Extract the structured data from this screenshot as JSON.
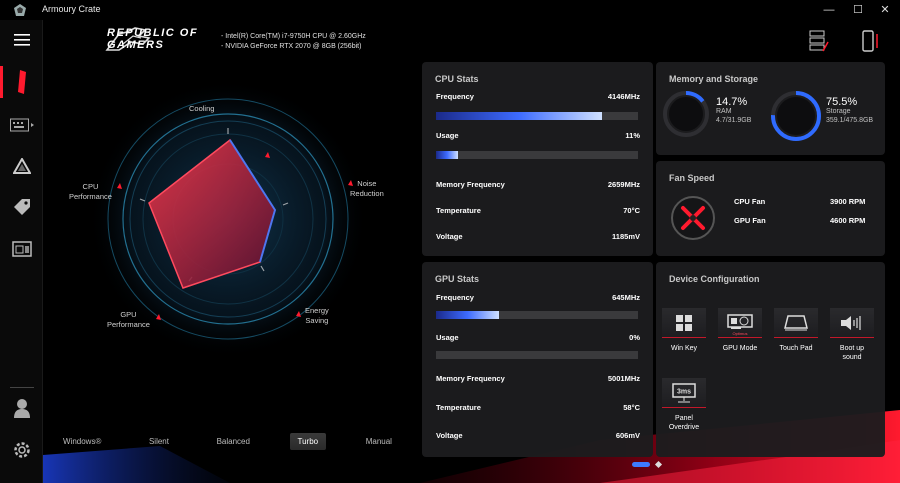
{
  "window": {
    "title": "Armoury Crate",
    "minimize": "—",
    "maximize": "☐",
    "close": "✕"
  },
  "header": {
    "logo_line1": "REPUBLIC OF",
    "logo_line2": "GAMERS",
    "cpu_spec": "-  Intel(R) Core(TM) i7-9750H CPU @ 2.60GHz",
    "gpu_spec": "-  NVIDIA GeForce RTX 2070 @ 8GB (256bit)"
  },
  "sidebar": {
    "items": [
      {
        "name": "menu",
        "icon": "hamburger-icon"
      },
      {
        "name": "home",
        "icon": "rog-eye-icon",
        "active": true
      },
      {
        "name": "keyboard",
        "icon": "keyboard-icon"
      },
      {
        "name": "aura",
        "icon": "triangle-icon"
      },
      {
        "name": "deals",
        "icon": "tag-icon"
      },
      {
        "name": "gamevisual",
        "icon": "gamevisual-icon"
      },
      {
        "name": "user",
        "icon": "user-icon"
      },
      {
        "name": "settings",
        "icon": "gear-icon"
      }
    ]
  },
  "radar": {
    "labels": {
      "cooling": "Cooling",
      "noise_line1": "Noise",
      "noise_line2": "Reduction",
      "energy_line1": "Energy",
      "energy_line2": "Saving",
      "gpu_line1": "GPU",
      "gpu_line2": "Performance",
      "cpu_line1": "CPU",
      "cpu_line2": "Performance"
    }
  },
  "modes": [
    {
      "label": "Windows®",
      "active": false
    },
    {
      "label": "Silent",
      "active": false
    },
    {
      "label": "Balanced",
      "active": false
    },
    {
      "label": "Turbo",
      "active": true
    },
    {
      "label": "Manual",
      "active": false
    }
  ],
  "cpu_stats": {
    "title": "CPU Stats",
    "frequency_label": "Frequency",
    "frequency": "4146MHz",
    "frequency_fill": 0.82,
    "usage_label": "Usage",
    "usage": "11%",
    "usage_fill": 0.11,
    "memfreq_label": "Memory Frequency",
    "memfreq": "2659MHz",
    "temp_label": "Temperature",
    "temp": "70°C",
    "voltage_label": "Voltage",
    "voltage": "1185mV"
  },
  "gpu_stats": {
    "title": "GPU Stats",
    "frequency_label": "Frequency",
    "frequency": "645MHz",
    "frequency_fill": 0.31,
    "usage_label": "Usage",
    "usage": "0%",
    "usage_fill": 0.0,
    "memfreq_label": "Memory Frequency",
    "memfreq": "5001MHz",
    "temp_label": "Temperature",
    "temp": "58°C",
    "voltage_label": "Voltage",
    "voltage": "606mV"
  },
  "memory": {
    "title": "Memory and Storage",
    "ram_percent": "14.7%",
    "ram_label": "RAM",
    "ram_detail": "4.7/31.9GB",
    "ram_fill": 0.147,
    "storage_percent": "75.5%",
    "storage_label": "Storage",
    "storage_detail": "359.1/475.8GB",
    "storage_fill": 0.755
  },
  "fan": {
    "title": "Fan Speed",
    "cpu_label": "CPU Fan",
    "cpu_value": "3900 RPM",
    "gpu_label": "GPU Fan",
    "gpu_value": "4600 RPM"
  },
  "device": {
    "title": "Device Configuration",
    "items": [
      {
        "label": "Win Key",
        "icon": "windows-key-icon"
      },
      {
        "label": "GPU Mode",
        "icon": "gpu-card-icon",
        "sub": "Optimus"
      },
      {
        "label": "Touch Pad",
        "icon": "touchpad-icon"
      },
      {
        "label": "Boot up sound",
        "icon": "boot-sound-icon"
      },
      {
        "label": "Panel Overdrive",
        "icon": "panel-overdrive-icon",
        "badge": "3ms"
      }
    ]
  },
  "colors": {
    "accent": "#ff1a2e",
    "panel": "#1c1c1e",
    "bar_blue": "#3d6bff"
  }
}
